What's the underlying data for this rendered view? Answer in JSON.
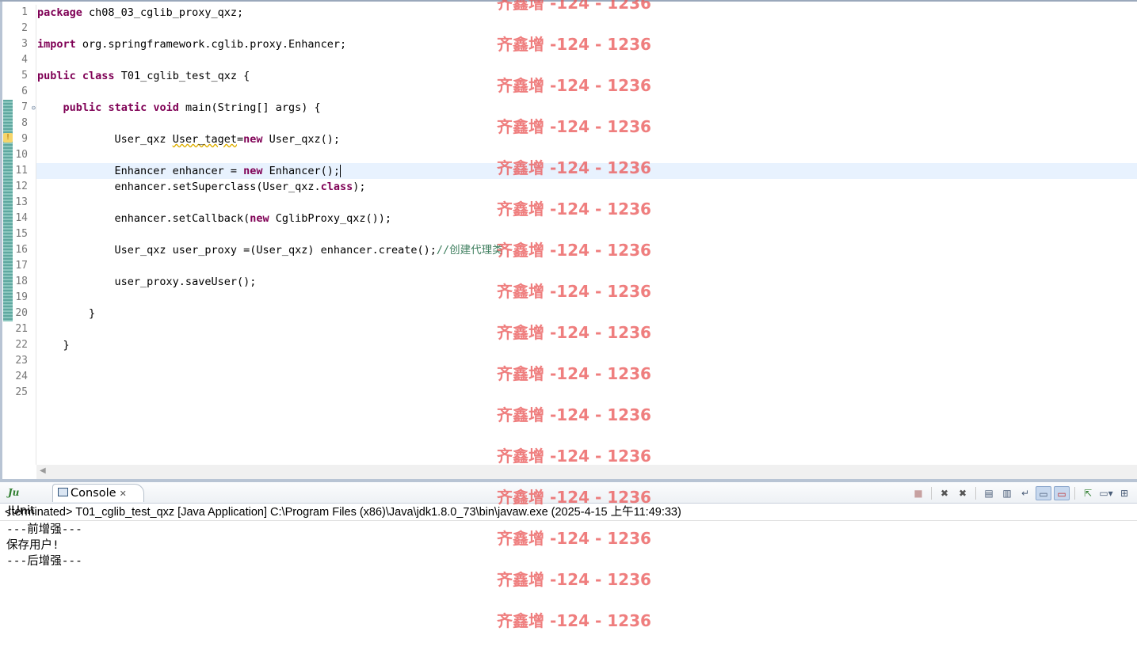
{
  "editor": {
    "lines": [
      [
        {
          "t": "package",
          "c": "kw"
        },
        {
          "t": " ch08_03_cglib_proxy_qxz;"
        }
      ],
      [],
      [
        {
          "t": "import",
          "c": "kw"
        },
        {
          "t": " org.springframework.cglib.proxy.Enhancer;"
        }
      ],
      [],
      [
        {
          "t": "public",
          "c": "kw"
        },
        {
          "t": " "
        },
        {
          "t": "class",
          "c": "kw"
        },
        {
          "t": " T01_cglib_test_qxz {"
        }
      ],
      [],
      [
        {
          "t": "    "
        },
        {
          "t": "public",
          "c": "kw"
        },
        {
          "t": " "
        },
        {
          "t": "static",
          "c": "kw"
        },
        {
          "t": " "
        },
        {
          "t": "void",
          "c": "kw"
        },
        {
          "t": " main(String[] args) {"
        }
      ],
      [],
      [
        {
          "t": "            User_qxz "
        },
        {
          "t": "User_taget",
          "c": "unused"
        },
        {
          "t": "="
        },
        {
          "t": "new",
          "c": "kw"
        },
        {
          "t": " User_qxz();"
        }
      ],
      [],
      [
        {
          "t": "            Enhancer enhancer = "
        },
        {
          "t": "new",
          "c": "kw"
        },
        {
          "t": " Enhancer();"
        }
      ],
      [
        {
          "t": "            enhancer.setSuperclass(User_qxz."
        },
        {
          "t": "class",
          "c": "kw"
        },
        {
          "t": ");"
        }
      ],
      [],
      [
        {
          "t": "            enhancer.setCallback("
        },
        {
          "t": "new",
          "c": "kw"
        },
        {
          "t": " CglibProxy_qxz());"
        }
      ],
      [],
      [
        {
          "t": "            User_qxz user_proxy =(User_qxz) enhancer.create();"
        },
        {
          "t": "//创建代理类",
          "c": "cm"
        }
      ],
      [],
      [
        {
          "t": "            user_proxy.saveUser();"
        }
      ],
      [],
      [
        {
          "t": "        }"
        }
      ],
      [],
      [
        {
          "t": "    }"
        }
      ],
      [],
      [],
      []
    ],
    "current_line": 11,
    "folded_line": 7,
    "warning_line": 9
  },
  "console": {
    "tabs": {
      "junit": "JUnit",
      "console": "Console"
    },
    "junit_icon": "Ju",
    "header": "<terminated> T01_cglib_test_qxz [Java Application] C:\\Program Files (x86)\\Java\\jdk1.8.0_73\\bin\\javaw.exe (2025-4-15 上午11:49:33)",
    "output": [
      "---前增强---",
      "保存用户!",
      "---后增强---"
    ],
    "toolbar_icons": [
      "terminate-icon",
      "remove-launch-icon",
      "remove-all-terminated-icon",
      "clear-console-icon",
      "scroll-lock-icon",
      "word-wrap-icon",
      "show-on-stdout-icon",
      "show-on-stderr-icon",
      "pin-console-icon",
      "display-selected-console-icon",
      "open-console-icon"
    ]
  },
  "watermark": {
    "text": "齐鑫增 -124 - 1236"
  },
  "colors": {
    "keyword": "#7f0055",
    "comment": "#3f7f5f",
    "current_line": "#e8f2fe",
    "watermark": "#eb5a5a"
  }
}
